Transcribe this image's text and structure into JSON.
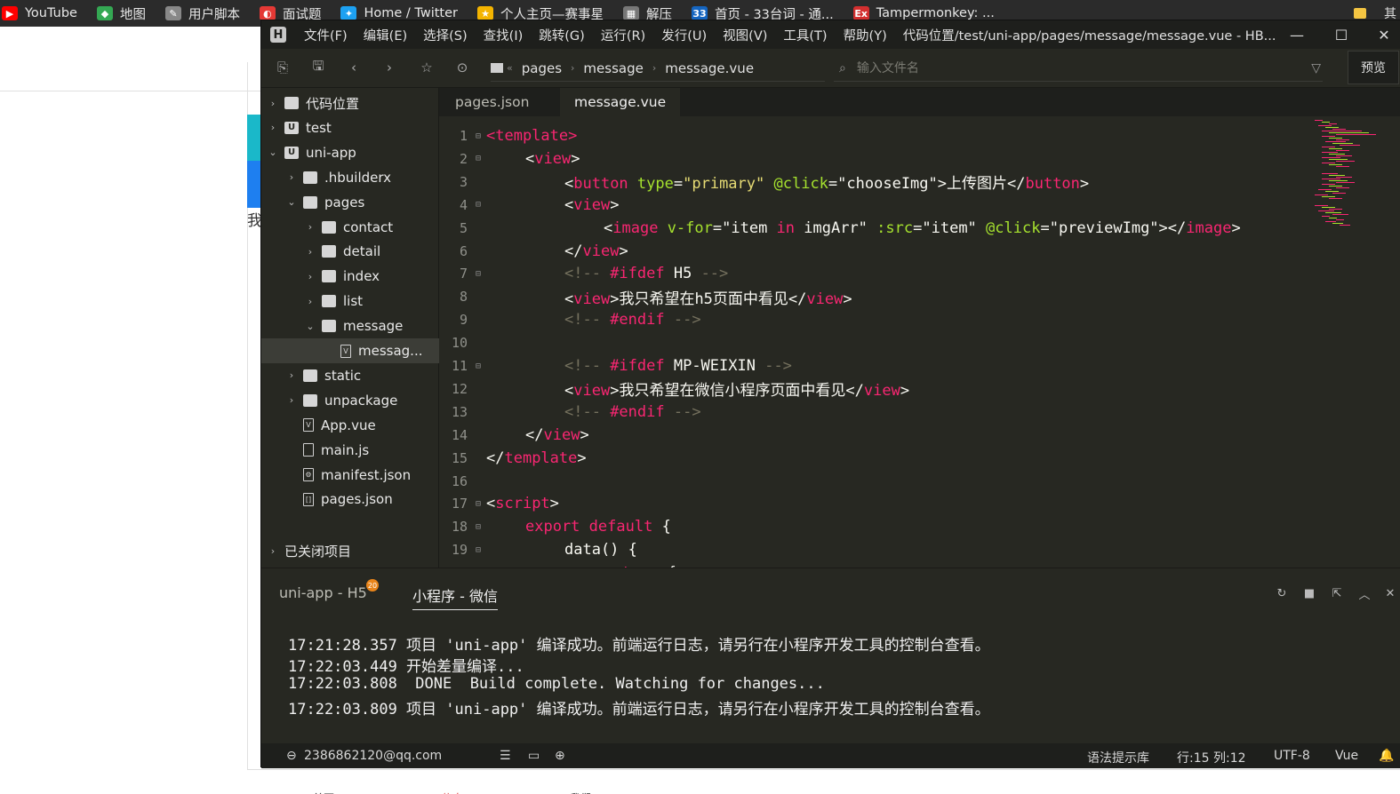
{
  "bookmarks": [
    {
      "label": "YouTube",
      "icon": "youtube-icon",
      "color": "#ff0000",
      "glyph": "▶"
    },
    {
      "label": "地图",
      "icon": "maps-icon",
      "color": "#34a853",
      "glyph": "◆"
    },
    {
      "label": "用户脚本",
      "icon": "wrench-icon",
      "color": "#888888",
      "glyph": "✎"
    },
    {
      "label": "面试题",
      "icon": "bookmark-red-icon",
      "color": "#e53935",
      "glyph": "◐"
    },
    {
      "label": "Home / Twitter",
      "icon": "twitter-icon",
      "color": "#1da1f2",
      "glyph": "✦"
    },
    {
      "label": "个人主页—赛事星",
      "icon": "star-icon",
      "color": "#f4b400",
      "glyph": "★"
    },
    {
      "label": "解压",
      "icon": "grid-icon",
      "color": "#777777",
      "glyph": "▦"
    },
    {
      "label": "首页 - 33台词 - 通...",
      "icon": "site-33-icon",
      "color": "#1565c0",
      "glyph": "33"
    },
    {
      "label": "Tampermonkey: ...",
      "icon": "extension-icon",
      "color": "#d32f2f",
      "glyph": "Ex"
    }
  ],
  "bookmarks_more": "其",
  "background_page": {
    "side_char": "我",
    "bottom_tabs": [
      "首页",
      "信息",
      "我们"
    ]
  },
  "editor": {
    "menus": [
      "文件(F)",
      "编辑(E)",
      "选择(S)",
      "查找(I)",
      "跳转(G)",
      "运行(R)",
      "发行(U)",
      "视图(V)",
      "工具(T)",
      "帮助(Y)"
    ],
    "title": "代码位置/test/uni-app/pages/message/message.vue - HB...",
    "breadcrumb": [
      "pages",
      "message",
      "message.vue"
    ],
    "file_search_placeholder": "输入文件名",
    "preview_label": "预览",
    "tabs": [
      "pages.json",
      "message.vue"
    ],
    "active_tab": 1
  },
  "tree": [
    {
      "label": "代码位置",
      "arrow": "›",
      "icon": "folder-icon",
      "depth": 0
    },
    {
      "label": "test",
      "arrow": "›",
      "icon": "project-icon",
      "depth": 0
    },
    {
      "label": "uni-app",
      "arrow": "⌄",
      "icon": "project-icon",
      "depth": 0
    },
    {
      "label": ".hbuilderx",
      "arrow": "›",
      "icon": "folder-icon",
      "depth": 1
    },
    {
      "label": "pages",
      "arrow": "⌄",
      "icon": "folder-open-icon",
      "depth": 1
    },
    {
      "label": "contact",
      "arrow": "›",
      "icon": "folder-icon",
      "depth": 2
    },
    {
      "label": "detail",
      "arrow": "›",
      "icon": "folder-icon",
      "depth": 2
    },
    {
      "label": "index",
      "arrow": "›",
      "icon": "folder-icon",
      "depth": 2
    },
    {
      "label": "list",
      "arrow": "›",
      "icon": "folder-icon",
      "depth": 2
    },
    {
      "label": "message",
      "arrow": "⌄",
      "icon": "folder-open-icon",
      "depth": 2
    },
    {
      "label": "messag...",
      "arrow": "",
      "icon": "vue-file-icon",
      "depth": 3,
      "selected": true
    },
    {
      "label": "static",
      "arrow": "›",
      "icon": "folder-icon",
      "depth": 1
    },
    {
      "label": "unpackage",
      "arrow": "›",
      "icon": "folder-icon",
      "depth": 1
    },
    {
      "label": "App.vue",
      "arrow": "",
      "icon": "vue-file-icon",
      "depth": 1
    },
    {
      "label": "main.js",
      "arrow": "",
      "icon": "js-file-icon",
      "depth": 1
    },
    {
      "label": "manifest.json",
      "arrow": "",
      "icon": "manifest-file-icon",
      "depth": 1
    },
    {
      "label": "pages.json",
      "arrow": "",
      "icon": "json-file-icon",
      "depth": 1
    }
  ],
  "closed_projects": "已关闭项目",
  "code_lines": [
    {
      "n": "1",
      "fold": "⊟",
      "indent": 0,
      "parts": [
        [
          "tg",
          "<template>"
        ]
      ]
    },
    {
      "n": "2",
      "fold": "⊟",
      "indent": 1,
      "parts": [
        [
          "wt",
          "<"
        ],
        [
          "tg",
          "view"
        ],
        [
          "wt",
          ">"
        ]
      ]
    },
    {
      "n": "3",
      "fold": "",
      "indent": 2,
      "parts": [
        [
          "wt",
          "<"
        ],
        [
          "tg",
          "button"
        ],
        [
          "wt",
          " "
        ],
        [
          "at",
          "type"
        ],
        [
          "wt",
          "="
        ],
        [
          "st",
          "\"primary\""
        ],
        [
          "wt",
          " "
        ],
        [
          "at",
          "@click"
        ],
        [
          "wt",
          "="
        ],
        [
          "wt",
          "\"chooseImg\""
        ],
        [
          "wt",
          ">上传图片</"
        ],
        [
          "tg",
          "button"
        ],
        [
          "wt",
          ">"
        ]
      ]
    },
    {
      "n": "4",
      "fold": "⊟",
      "indent": 2,
      "parts": [
        [
          "wt",
          "<"
        ],
        [
          "tg",
          "view"
        ],
        [
          "wt",
          ">"
        ]
      ]
    },
    {
      "n": "5",
      "fold": "",
      "indent": 3,
      "parts": [
        [
          "wt",
          "<"
        ],
        [
          "tg",
          "image"
        ],
        [
          "wt",
          " "
        ],
        [
          "at",
          "v-for"
        ],
        [
          "wt",
          "="
        ],
        [
          "wt",
          "\"item "
        ],
        [
          "kw",
          "in"
        ],
        [
          "wt",
          " imgArr\""
        ],
        [
          "wt",
          " "
        ],
        [
          "at",
          ":src"
        ],
        [
          "wt",
          "="
        ],
        [
          "wt",
          "\"item\""
        ],
        [
          "wt",
          " "
        ],
        [
          "at",
          "@click"
        ],
        [
          "wt",
          "="
        ],
        [
          "wt",
          "\"previewImg\""
        ],
        [
          "wt",
          "></"
        ],
        [
          "tg",
          "image"
        ],
        [
          "wt",
          ">"
        ]
      ]
    },
    {
      "n": "6",
      "fold": "",
      "indent": 2,
      "parts": [
        [
          "wt",
          "</"
        ],
        [
          "tg",
          "view"
        ],
        [
          "wt",
          ">"
        ]
      ]
    },
    {
      "n": "7",
      "fold": "⊟",
      "indent": 2,
      "parts": [
        [
          "cm",
          "<!-- "
        ],
        [
          "pp",
          "#ifdef"
        ],
        [
          "wt",
          " H5 "
        ],
        [
          "cm",
          "-->"
        ]
      ]
    },
    {
      "n": "8",
      "fold": "",
      "indent": 2,
      "parts": [
        [
          "wt",
          "<"
        ],
        [
          "tg",
          "view"
        ],
        [
          "wt",
          ">我只希望在h5页面中看见</"
        ],
        [
          "tg",
          "view"
        ],
        [
          "wt",
          ">"
        ]
      ]
    },
    {
      "n": "9",
      "fold": "",
      "indent": 2,
      "parts": [
        [
          "cm",
          "<!-- "
        ],
        [
          "pp",
          "#endif"
        ],
        [
          "cm",
          " -->"
        ]
      ]
    },
    {
      "n": "10",
      "fold": "",
      "indent": 0,
      "parts": []
    },
    {
      "n": "11",
      "fold": "⊟",
      "indent": 2,
      "parts": [
        [
          "cm",
          "<!-- "
        ],
        [
          "pp",
          "#ifdef"
        ],
        [
          "wt",
          " MP-WEIXIN "
        ],
        [
          "cm",
          "-->"
        ]
      ]
    },
    {
      "n": "12",
      "fold": "",
      "indent": 2,
      "parts": [
        [
          "wt",
          "<"
        ],
        [
          "tg",
          "view"
        ],
        [
          "wt",
          ">我只希望在微信小程序页面中看见</"
        ],
        [
          "tg",
          "view"
        ],
        [
          "wt",
          ">"
        ]
      ]
    },
    {
      "n": "13",
      "fold": "",
      "indent": 2,
      "parts": [
        [
          "cm",
          "<!-- "
        ],
        [
          "pp",
          "#endif"
        ],
        [
          "cm",
          " -->"
        ]
      ]
    },
    {
      "n": "14",
      "fold": "",
      "indent": 1,
      "parts": [
        [
          "wt",
          "</"
        ],
        [
          "tg",
          "view"
        ],
        [
          "wt",
          ">"
        ]
      ]
    },
    {
      "n": "15",
      "fold": "",
      "indent": 0,
      "parts": [
        [
          "wt",
          "</"
        ],
        [
          "tg",
          "template"
        ],
        [
          "wt",
          ">"
        ]
      ]
    },
    {
      "n": "16",
      "fold": "",
      "indent": 0,
      "parts": []
    },
    {
      "n": "17",
      "fold": "⊟",
      "indent": 0,
      "parts": [
        [
          "wt",
          "<"
        ],
        [
          "tg",
          "script"
        ],
        [
          "wt",
          ">"
        ]
      ]
    },
    {
      "n": "18",
      "fold": "⊟",
      "indent": 1,
      "parts": [
        [
          "kw",
          "export"
        ],
        [
          "wt",
          " "
        ],
        [
          "kw",
          "default"
        ],
        [
          "wt",
          " {"
        ]
      ]
    },
    {
      "n": "19",
      "fold": "⊟",
      "indent": 2,
      "parts": [
        [
          "wt",
          "data() {"
        ]
      ]
    },
    {
      "n": "20",
      "fold": "⊟",
      "indent": 3,
      "parts": [
        [
          "kw",
          "return"
        ],
        [
          "wt",
          " {"
        ]
      ]
    }
  ],
  "console": {
    "tabs": [
      "uni-app - H5",
      "小程序 - 微信"
    ],
    "active_tab": 1,
    "badge": "20",
    "logs": [
      "17:21:28.357 项目 'uni-app' 编译成功。前端运行日志，请另行在小程序开发工具的控制台查看。",
      "17:22:03.449 开始差量编译...",
      "17:22:03.808  DONE  Build complete. Watching for changes...",
      "17:22:03.809 项目 'uni-app' 编译成功。前端运行日志，请另行在小程序开发工具的控制台查看。"
    ]
  },
  "status": {
    "account": "2386862120@qq.com",
    "syntax_lib": "语法提示库",
    "position": "行:15  列:12",
    "encoding": "UTF-8",
    "language": "Vue"
  }
}
